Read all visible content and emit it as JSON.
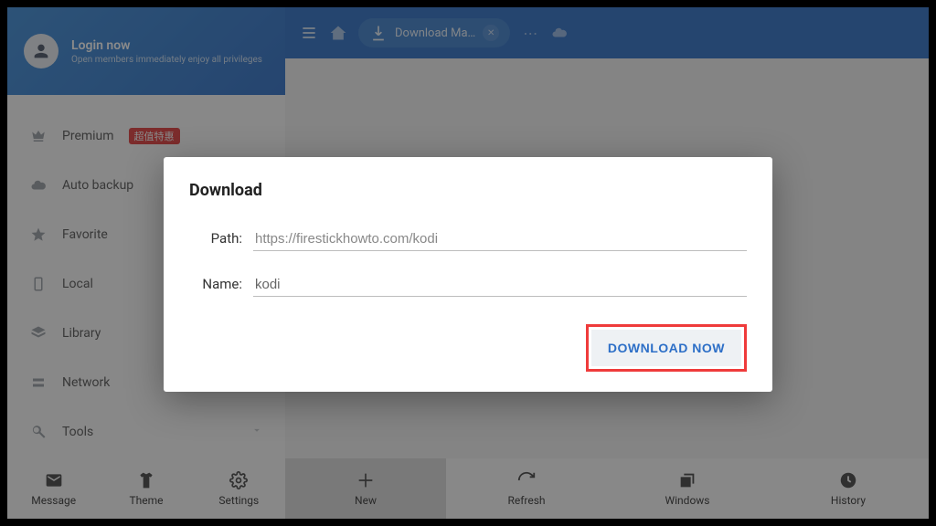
{
  "sidebar": {
    "login_title": "Login now",
    "login_sub": "Open members immediately enjoy all privileges",
    "items": [
      {
        "label": "Premium",
        "badge": "超值特惠"
      },
      {
        "label": "Auto backup"
      },
      {
        "label": "Favorite"
      },
      {
        "label": "Local"
      },
      {
        "label": "Library"
      },
      {
        "label": "Network"
      },
      {
        "label": "Tools"
      }
    ]
  },
  "topbar": {
    "tab_label": "Download Ma…"
  },
  "bottombar": {
    "left": [
      "Message",
      "Theme",
      "Settings"
    ],
    "right": [
      "New",
      "Refresh",
      "Windows",
      "History"
    ]
  },
  "dialog": {
    "title": "Download",
    "path_label": "Path:",
    "path_value": "https://firestickhowto.com/kodi",
    "name_label": "Name:",
    "name_value": "kodi",
    "button": "DOWNLOAD NOW"
  }
}
